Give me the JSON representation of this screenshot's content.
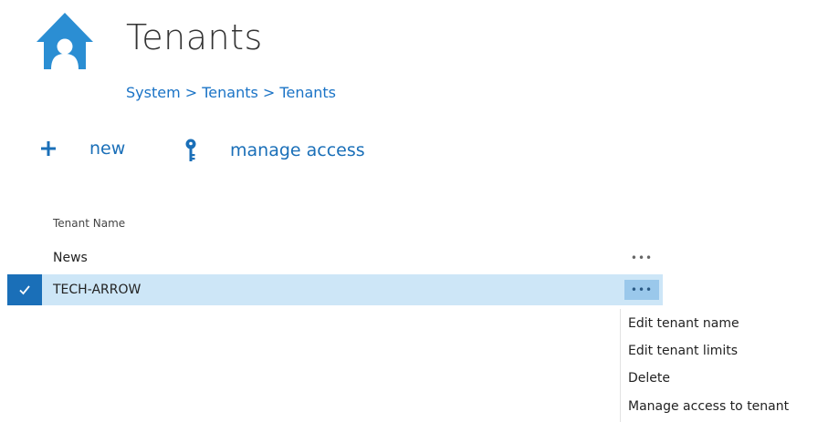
{
  "header": {
    "title": "Tenants",
    "breadcrumb": "System > Tenants > Tenants",
    "icon": "home-icon"
  },
  "toolbar": {
    "new_label": "new",
    "manage_access_label": "manage access"
  },
  "table": {
    "column_header": "Tenant Name",
    "rows": [
      {
        "name": "News",
        "more": "•••",
        "selected": false
      },
      {
        "name": "TECH-ARROW",
        "more": "•••",
        "selected": true
      }
    ]
  },
  "context_menu": {
    "items": [
      "Edit tenant name",
      "Edit tenant limits",
      "Delete",
      "Manage access to tenant"
    ]
  },
  "colors": {
    "accent": "#1a6fb8",
    "selected_row": "#cde6f7",
    "home_icon": "#2b8ed3"
  }
}
